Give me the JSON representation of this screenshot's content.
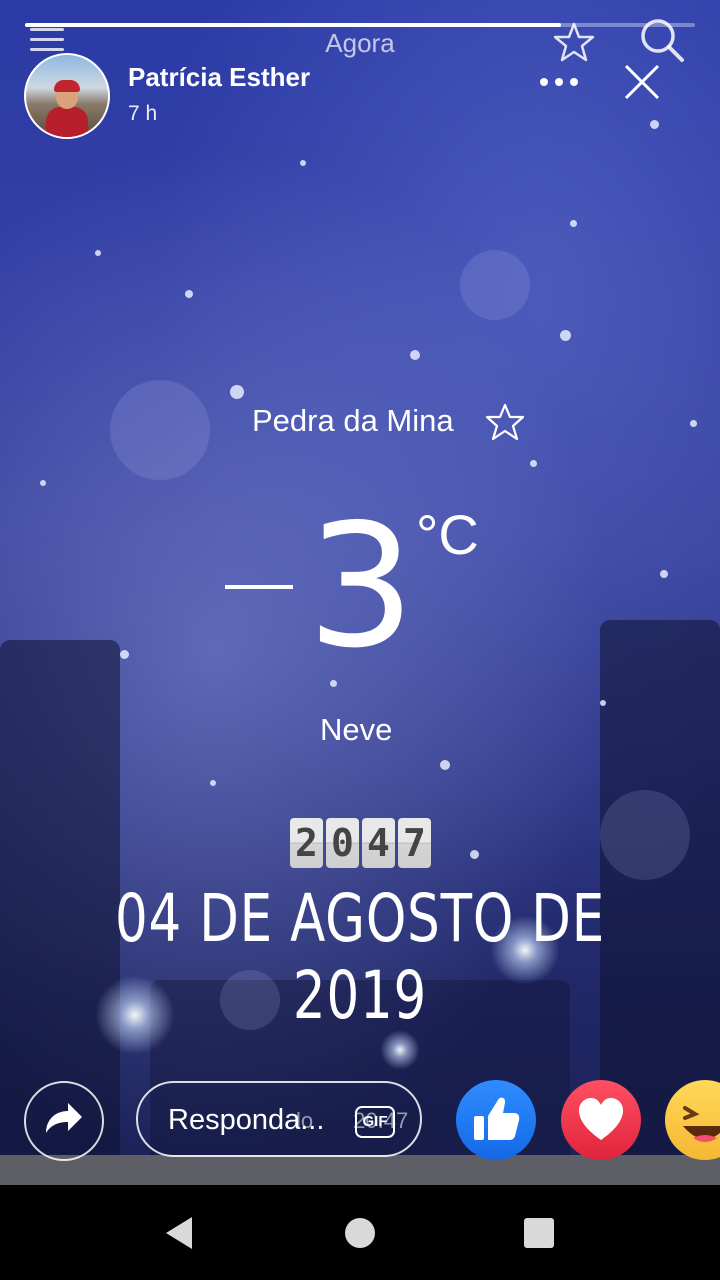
{
  "story": {
    "header_title": "Agora",
    "progress": 0.8,
    "author": {
      "name": "Patrícia Esther",
      "time": "7 h"
    }
  },
  "weather": {
    "location": "Pedra da Mina",
    "temperature_minus": "-",
    "temperature_value": "3",
    "unit": "°C",
    "condition": "Neve",
    "clock_digits": [
      "2",
      "0",
      "4",
      "7"
    ],
    "date": "04 DE AGOSTO DE 2019"
  },
  "reply": {
    "placeholder": "Responda...",
    "ghost_text": "lo",
    "gif_label": "GIF",
    "timestamp": "20:47"
  },
  "colors": {
    "like": "#1877f2",
    "love": "#f33e58",
    "haha": "#f7b125"
  },
  "icons": {
    "menu": "menu-icon",
    "star": "star-icon",
    "search": "search-icon",
    "more": "more-icon",
    "close": "close-icon",
    "share": "share-icon",
    "like": "thumbs-up-icon",
    "love": "heart-icon",
    "haha": "laughing-face-icon",
    "back": "back-triangle-icon",
    "home": "home-circle-icon",
    "recents": "recents-square-icon"
  }
}
